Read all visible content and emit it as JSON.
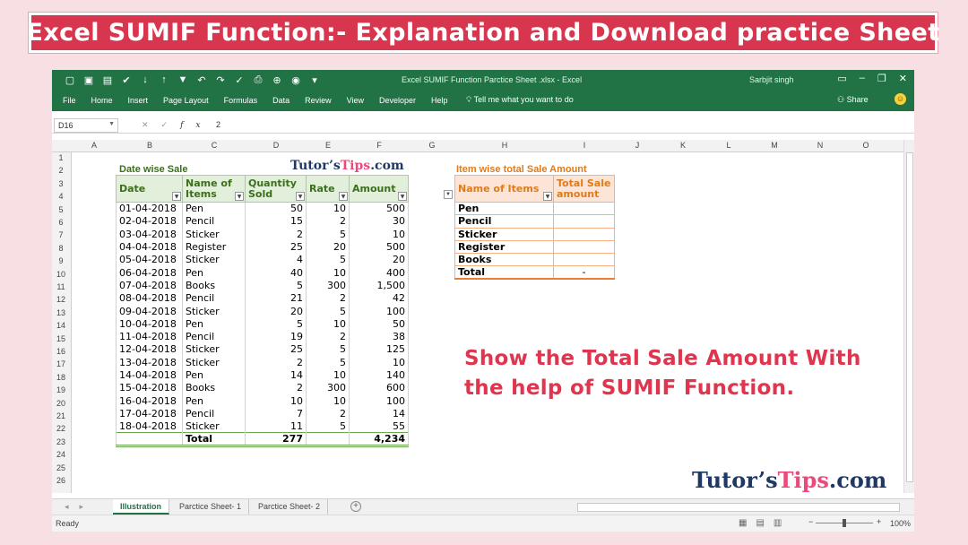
{
  "banner": {
    "title": "Excel SUMIF Function:- Explanation and Download practice Sheet"
  },
  "window": {
    "title": "Excel SUMIF Function Parctice Sheet .xlsx  -  Excel",
    "user": "Sarbjit singh",
    "ribbon_color": "#217346",
    "tabs": [
      "File",
      "Home",
      "Insert",
      "Page Layout",
      "Formulas",
      "Data",
      "Review",
      "View",
      "Developer",
      "Help"
    ],
    "tell_me": "Tell me what you want to do",
    "share": "Share"
  },
  "formula_bar": {
    "name_box": "D16",
    "fx_label": "fx",
    "value": "2"
  },
  "columns": [
    "A",
    "B",
    "C",
    "D",
    "E",
    "F",
    "G",
    "H",
    "I",
    "J",
    "K",
    "L",
    "M",
    "N",
    "O"
  ],
  "rows": [
    "1",
    "2",
    "3",
    "4",
    "5",
    "6",
    "7",
    "8",
    "9",
    "10",
    "11",
    "12",
    "13",
    "14",
    "15",
    "16",
    "17",
    "18",
    "19",
    "20",
    "21",
    "22",
    "23",
    "24",
    "25",
    "26"
  ],
  "table1": {
    "title": "Date wise Sale",
    "headers": [
      "Date",
      "Name of Items",
      "Quantity Sold",
      "Rate",
      "Amount"
    ],
    "rows": [
      [
        "01-04-2018",
        "Pen",
        "50",
        "10",
        "500"
      ],
      [
        "02-04-2018",
        "Pencil",
        "15",
        "2",
        "30"
      ],
      [
        "03-04-2018",
        "Sticker",
        "2",
        "5",
        "10"
      ],
      [
        "04-04-2018",
        "Register",
        "25",
        "20",
        "500"
      ],
      [
        "05-04-2018",
        "Sticker",
        "4",
        "5",
        "20"
      ],
      [
        "06-04-2018",
        "Pen",
        "40",
        "10",
        "400"
      ],
      [
        "07-04-2018",
        "Books",
        "5",
        "300",
        "1,500"
      ],
      [
        "08-04-2018",
        "Pencil",
        "21",
        "2",
        "42"
      ],
      [
        "09-04-2018",
        "Sticker",
        "20",
        "5",
        "100"
      ],
      [
        "10-04-2018",
        "Pen",
        "5",
        "10",
        "50"
      ],
      [
        "11-04-2018",
        "Pencil",
        "19",
        "2",
        "38"
      ],
      [
        "12-04-2018",
        "Sticker",
        "25",
        "5",
        "125"
      ],
      [
        "13-04-2018",
        "Sticker",
        "2",
        "5",
        "10"
      ],
      [
        "14-04-2018",
        "Pen",
        "14",
        "10",
        "140"
      ],
      [
        "15-04-2018",
        "Books",
        "2",
        "300",
        "600"
      ],
      [
        "16-04-2018",
        "Pen",
        "10",
        "10",
        "100"
      ],
      [
        "17-04-2018",
        "Pencil",
        "7",
        "2",
        "14"
      ],
      [
        "18-04-2018",
        "Sticker",
        "11",
        "5",
        "55"
      ]
    ],
    "total": {
      "label": "Total",
      "quantity": "277",
      "amount": "4,234"
    }
  },
  "brand": {
    "part1": "Tutor’s",
    "part2": "Tips",
    "part3": ".com"
  },
  "table2": {
    "title": "Item wise total Sale Amount",
    "headers": [
      "Name of Items",
      "Total Sale amount"
    ],
    "items": [
      "Pen",
      "Pencil",
      "Sticker",
      "Register",
      "Books"
    ],
    "total_label": "Total",
    "total_value": "-"
  },
  "note": "Show the Total Sale Amount With the help of SUMIF Function.",
  "sheet_tabs": [
    "Illustration",
    "Parctice Sheet- 1",
    "Parctice Sheet- 2"
  ],
  "status": {
    "ready": "Ready",
    "zoom": "100%"
  }
}
